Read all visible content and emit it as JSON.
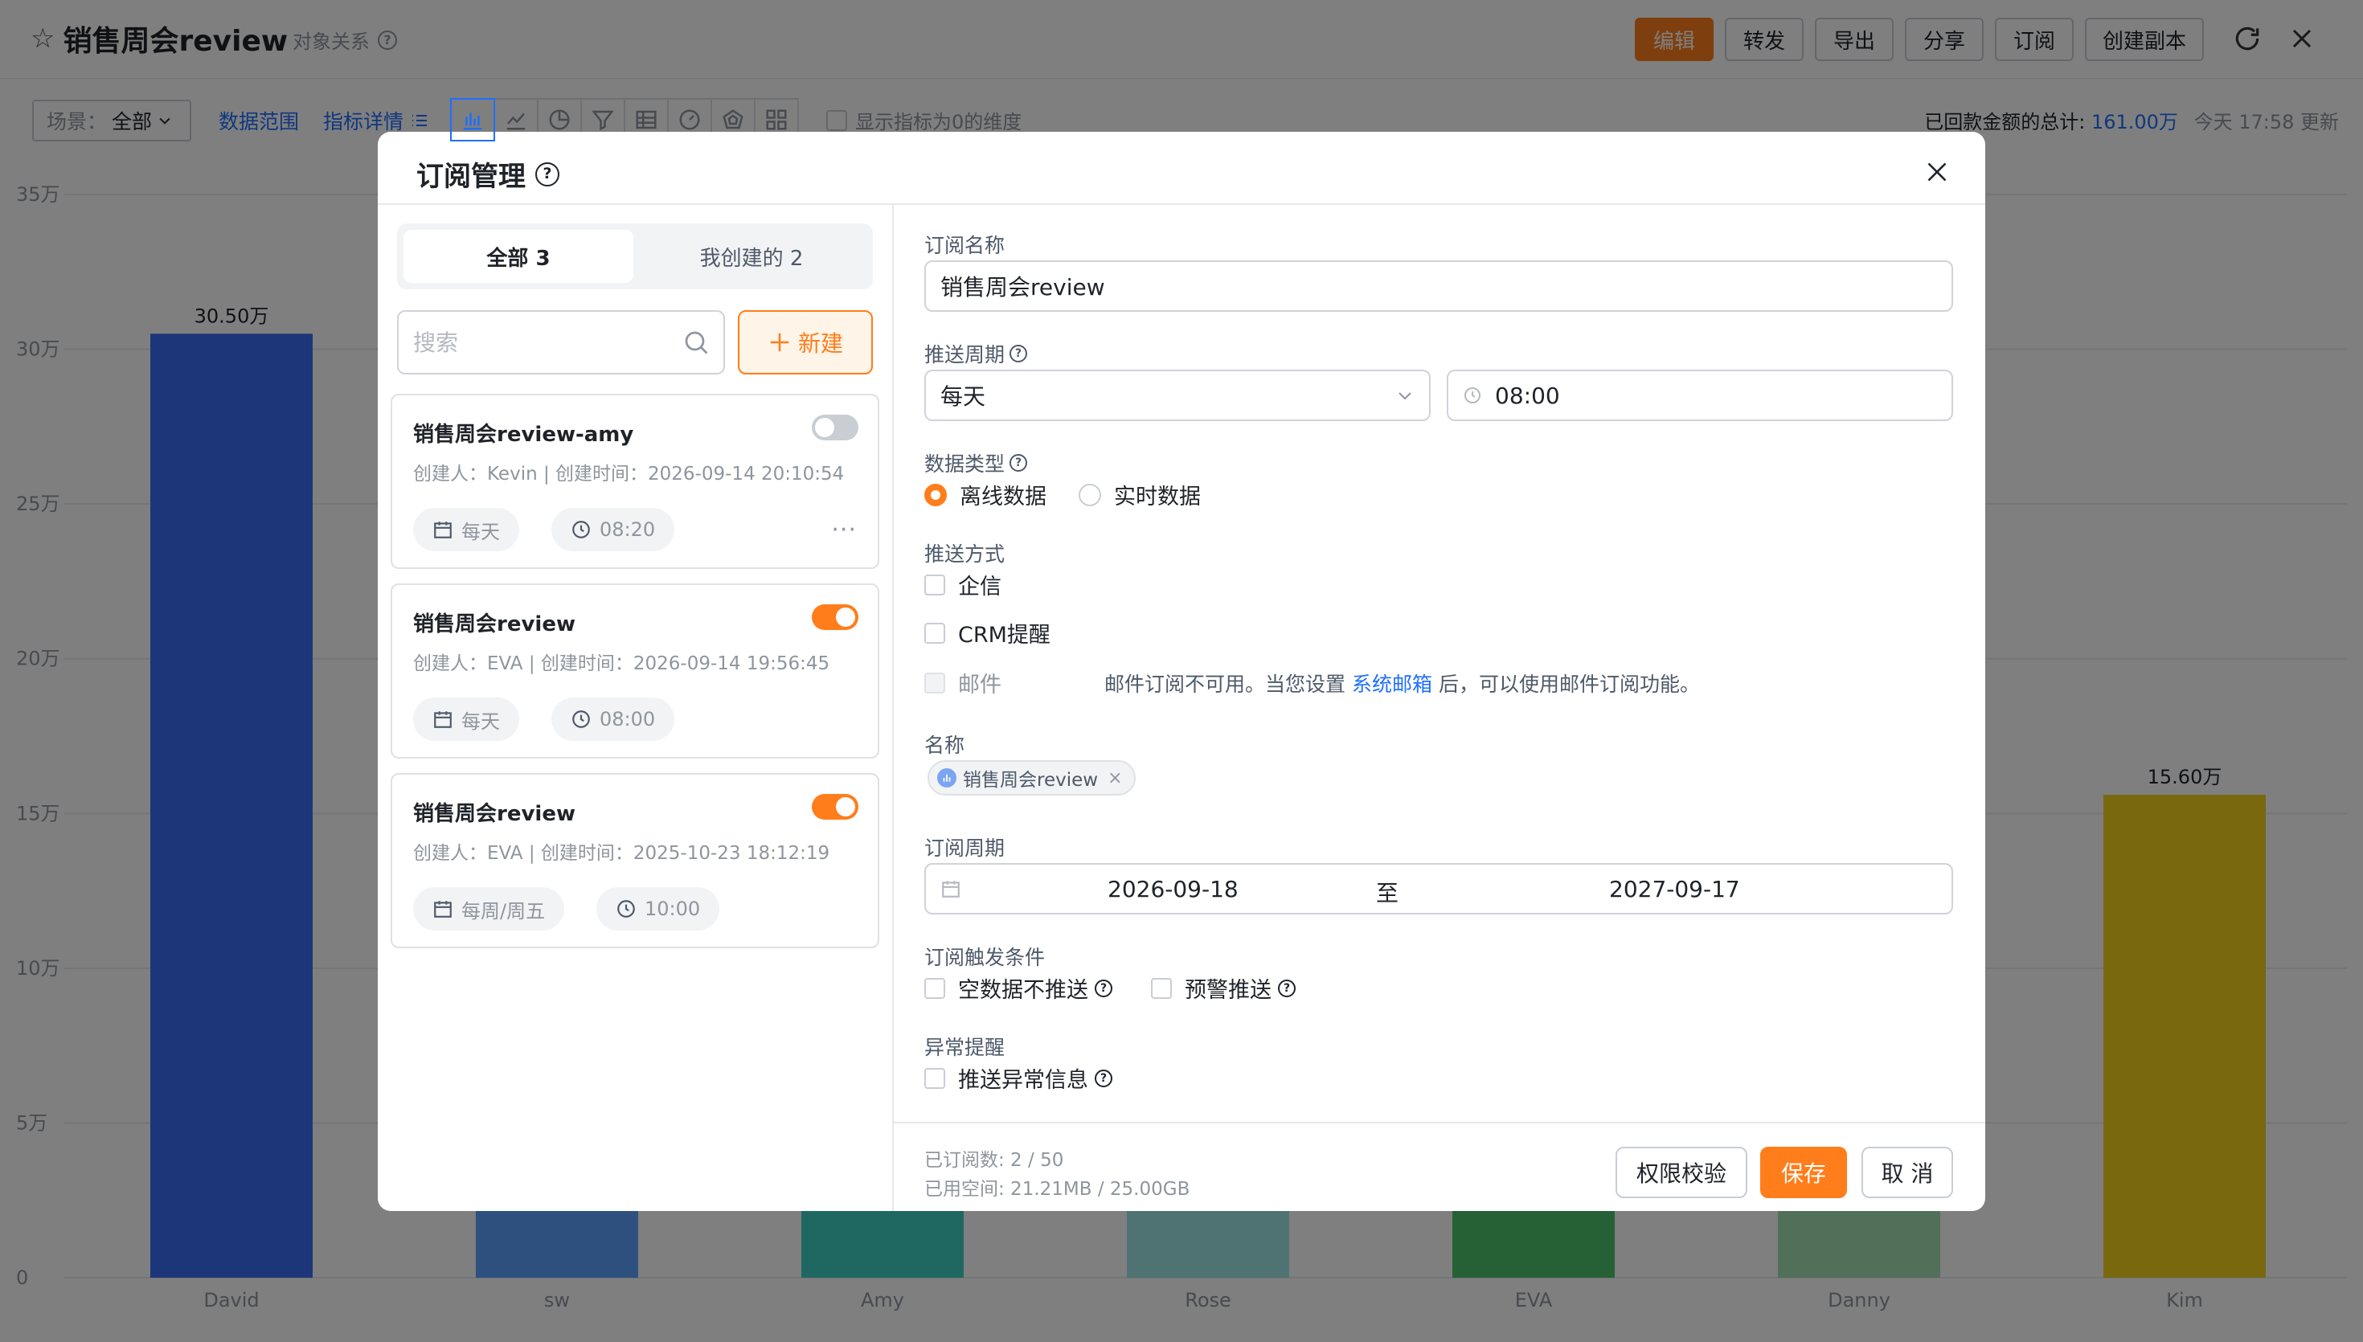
{
  "header": {
    "title": "销售周会review",
    "object_relation": "对象关系",
    "buttons": {
      "edit": "编辑",
      "forward": "转发",
      "export": "导出",
      "share": "分享",
      "subscribe": "订阅",
      "duplicate": "创建副本"
    }
  },
  "filters": {
    "scene_label": "场景：",
    "scene_value": "全部",
    "data_range": "数据范围",
    "metric_detail": "指标详情",
    "show_zero_dims": "显示指标为0的维度",
    "total_label": "已回款金额的总计:",
    "total_value": "161.00万",
    "updated": "今天 17:58 更新"
  },
  "chart_data": {
    "type": "bar",
    "categories": [
      "David",
      "sw",
      "Amy",
      "Rose",
      "EVA",
      "Danny",
      "Kim"
    ],
    "values": [
      30.5,
      10.0,
      10.0,
      10.0,
      10.0,
      10.0,
      15.6
    ],
    "value_labels": [
      "30.50万",
      "",
      "",
      "",
      "",
      "",
      "15.60万"
    ],
    "colors": [
      "#3b6cf2",
      "#5aa0ff",
      "#3ed0c4",
      "#9ee6e6",
      "#4cc36a",
      "#a2e0b5",
      "#f3d01c"
    ],
    "ylim": [
      0,
      35
    ],
    "yticks": [
      "0",
      "5万",
      "10万",
      "15万",
      "20万",
      "25万",
      "30万",
      "35万"
    ],
    "grid": true
  },
  "modal": {
    "title": "订阅管理",
    "tabs": {
      "all": "全部 3",
      "mine": "我创建的 2"
    },
    "search_placeholder": "搜索",
    "new_button": "新建",
    "cards": [
      {
        "name": "销售周会review-amy",
        "meta": "创建人：Kevin  |  创建时间：2026-09-14 20:10:54",
        "cycle": "每天",
        "time": "08:20",
        "enabled": false
      },
      {
        "name": "销售周会review",
        "meta": "创建人：EVA  |  创建时间：2026-09-14 19:56:45",
        "cycle": "每天",
        "time": "08:00",
        "enabled": true
      },
      {
        "name": "销售周会review",
        "meta": "创建人：EVA  |  创建时间：2025-10-23 18:12:19",
        "cycle": "每周/周五",
        "time": "10:00",
        "enabled": true
      }
    ],
    "form": {
      "name_label": "订阅名称",
      "name_value": "销售周会review",
      "cycle_label": "推送周期",
      "cycle_value": "每天",
      "time_value": "08:00",
      "datatype_label": "数据类型",
      "datatype_offline": "离线数据",
      "datatype_realtime": "实时数据",
      "push_label": "推送方式",
      "push_wecom": "企信",
      "push_crm": "CRM提醒",
      "push_mail": "邮件",
      "mail_note_prefix": "邮件订阅不可用。当您设置",
      "mail_note_link": "系统邮箱",
      "mail_note_suffix": "后，可以使用邮件订阅功能。",
      "target_label": "名称",
      "target_tag": "销售周会review",
      "period_label": "订阅周期",
      "period_start": "2026-09-18",
      "period_to": "至",
      "period_end": "2027-09-17",
      "trigger_label": "订阅触发条件",
      "trigger_empty": "空数据不推送",
      "trigger_alert": "预警推送",
      "abnormal_label": "异常提醒",
      "abnormal_push": "推送异常信息"
    },
    "footer": {
      "subscribed": "已订阅数: 2 / 50",
      "space": "已用空间:  21.21MB / 25.00GB",
      "check": "权限校验",
      "save": "保存",
      "cancel": "取 消"
    }
  }
}
